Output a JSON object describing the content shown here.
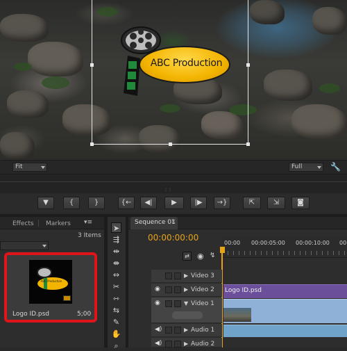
{
  "monitor": {
    "zoom_label": "Fit",
    "quality_label": "Full"
  },
  "logo": {
    "text": "ABC Production",
    "colors": {
      "ellipse": "#f3b400",
      "film": "#1f8b3a"
    }
  },
  "transport": {
    "buttons": [
      {
        "name": "add-marker-button",
        "glyph": "▼"
      },
      {
        "name": "mark-in-button",
        "glyph": "{"
      },
      {
        "name": "mark-out-button",
        "glyph": "}"
      },
      {
        "name": "go-to-in-button",
        "glyph": "{←"
      },
      {
        "name": "step-back-button",
        "glyph": "◀|"
      },
      {
        "name": "play-button",
        "glyph": "▶"
      },
      {
        "name": "step-forward-button",
        "glyph": "|▶"
      },
      {
        "name": "go-to-out-button",
        "glyph": "→}"
      },
      {
        "name": "lift-button",
        "glyph": "⇱"
      },
      {
        "name": "extract-button",
        "glyph": "⇲"
      },
      {
        "name": "export-frame-button",
        "glyph": "◙"
      }
    ]
  },
  "project": {
    "tabs": [
      "Effects",
      "Markers"
    ],
    "items_count": "3 Items",
    "clip": {
      "name": "Logo ID.psd",
      "duration": "5;00",
      "thumb_text": "ABC Production"
    }
  },
  "sequence": {
    "tab": "Sequence 01",
    "timecode": "00:00:00:00",
    "ruler": [
      "00:00",
      "00:00:05:00",
      "00:00:10:00",
      "00"
    ],
    "tracks": [
      {
        "label": "Video 3"
      },
      {
        "label": "Video 2",
        "clip": "Logo ID.psd"
      },
      {
        "label": "Video 1"
      },
      {
        "label": "Audio 1"
      },
      {
        "label": "Audio 2"
      }
    ]
  },
  "colors": {
    "accent_timecode": "#e8a317",
    "clip_purple": "#6b4f9a",
    "clip_blue": "#8fb1d8",
    "audio_green": "#6fa3c9",
    "highlight_red": "#e0141a"
  }
}
